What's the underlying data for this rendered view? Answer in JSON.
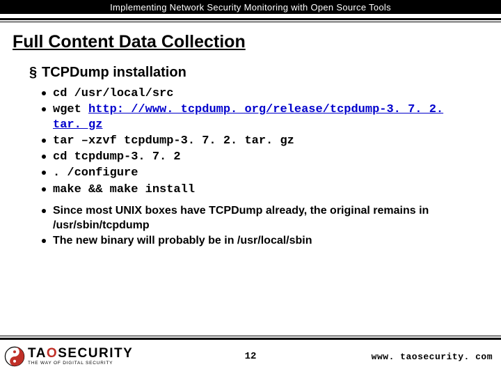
{
  "header": {
    "title": "Implementing Network Security Monitoring with Open Source Tools"
  },
  "slide": {
    "title": "Full Content Data Collection",
    "section": "TCPDump installation",
    "cmds": {
      "cd_src": "cd /usr/local/src",
      "wget_prefix": "wget ",
      "wget_url": "http: //www. tcpdump. org/release/tcpdump-3. 7. 2. tar. gz",
      "tar": "tar –xzvf tcpdump-3. 7. 2. tar. gz",
      "cd_pkg": "cd tcpdump-3. 7. 2",
      "configure": ". /configure",
      "make": "make && make install"
    },
    "notes": {
      "n1": "Since most UNIX boxes have TCPDump already, the original remains in /usr/sbin/tcpdump",
      "n2": "The new binary will probably be in /usr/local/sbin"
    }
  },
  "footer": {
    "page": "12",
    "url": "www. taosecurity. com",
    "logo_sub": "THE WAY OF DIGITAL SECURITY"
  }
}
